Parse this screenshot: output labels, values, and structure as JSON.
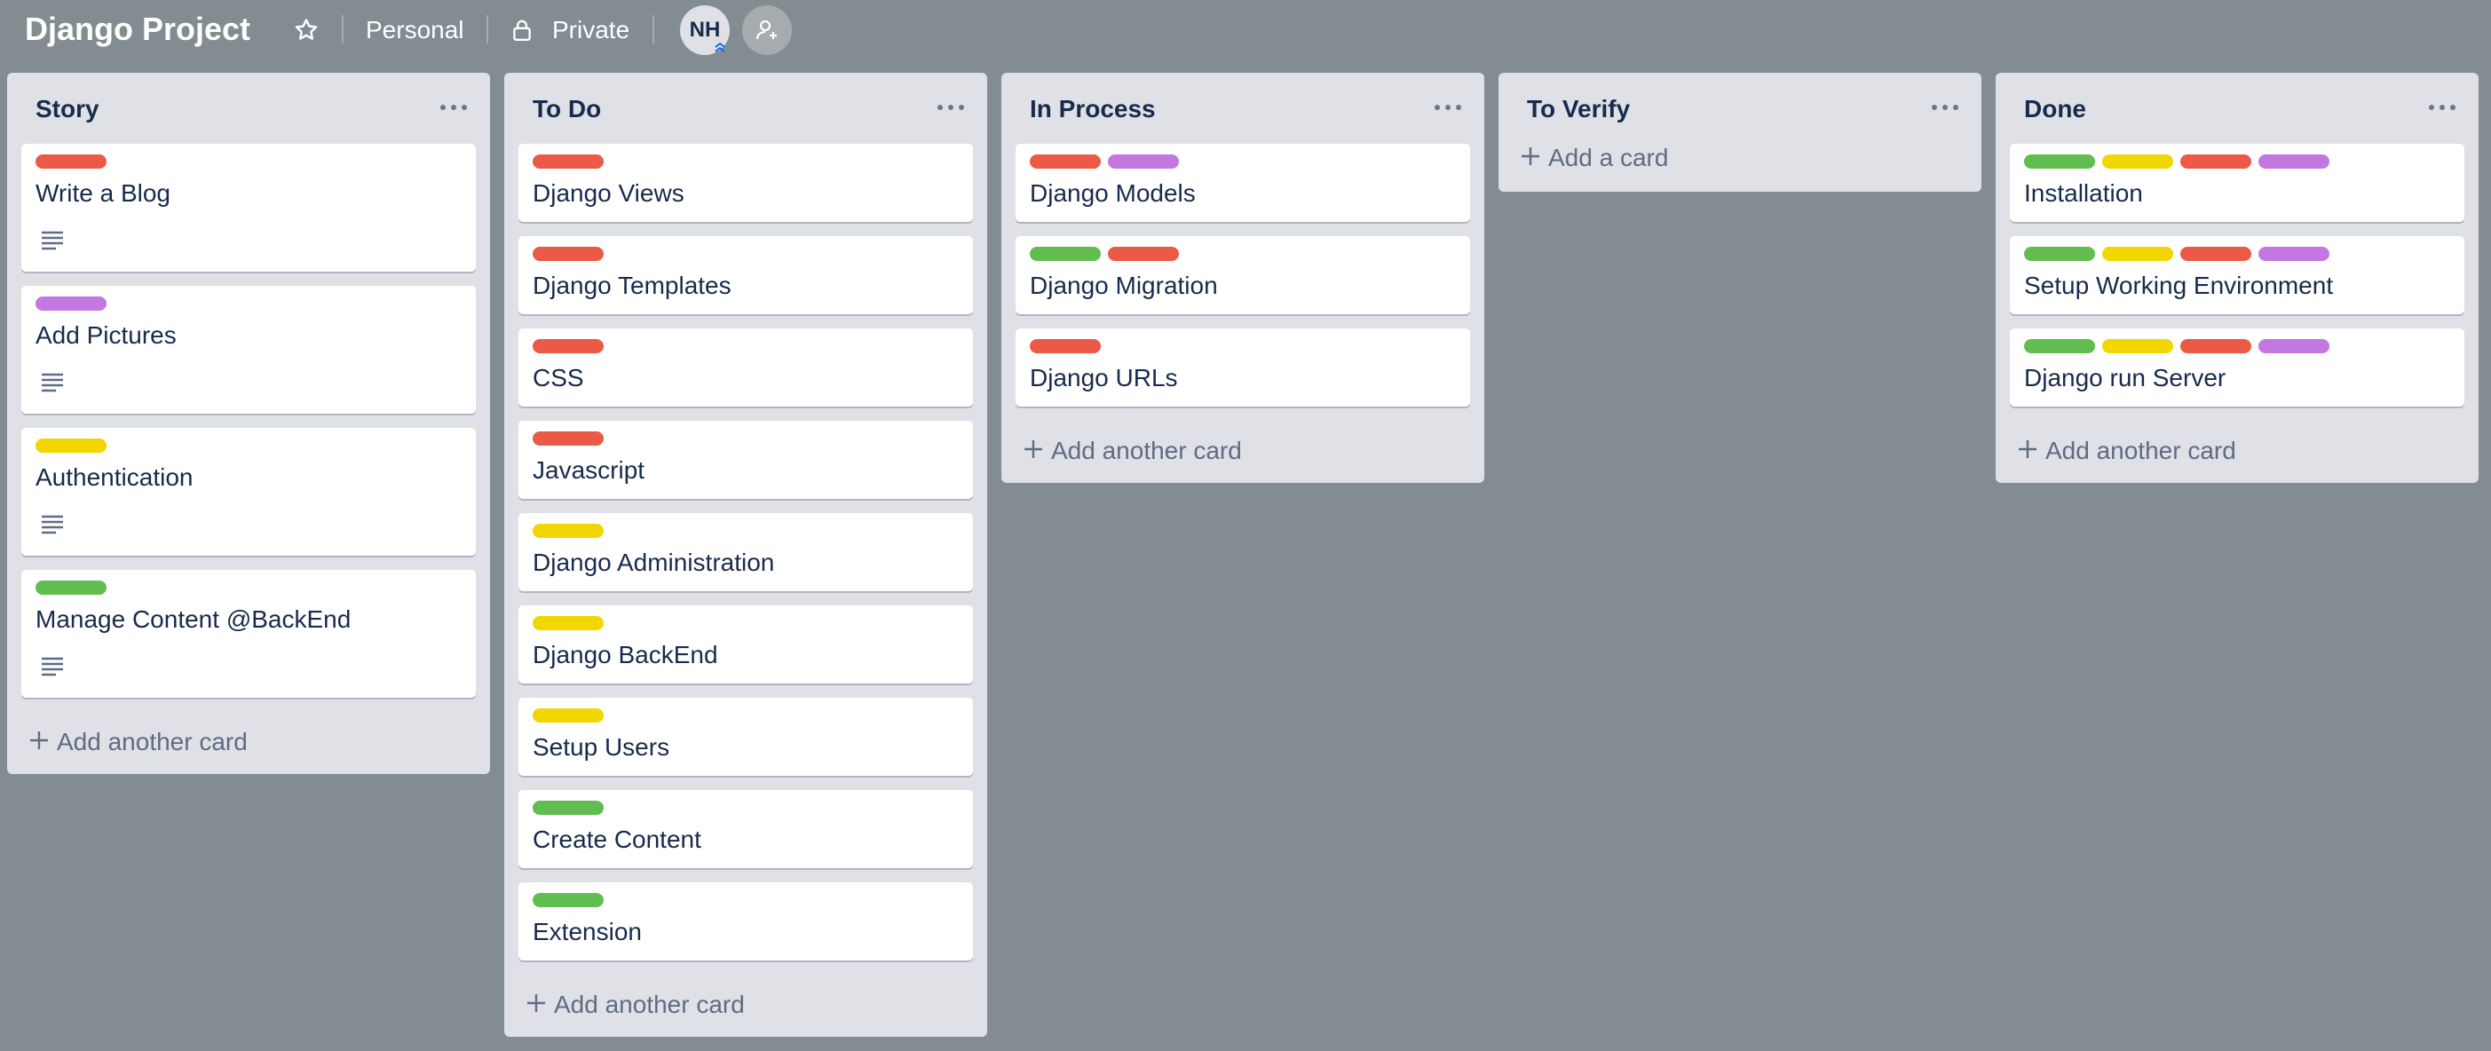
{
  "board": {
    "title": "Django Project",
    "visibility_team": "Personal",
    "visibility": "Private",
    "member_initials": "NH"
  },
  "colors": {
    "background": "#838c91",
    "list_background": "#dfe1e6",
    "label_red": "#eb5a46",
    "label_purple": "#c377e0",
    "label_yellow": "#f2d600",
    "label_green": "#61bd4f"
  },
  "icons": {
    "star": "star-icon",
    "lock": "lock-icon",
    "add_member": "add-member-icon",
    "list_menu": "ellipsis-icon",
    "description": "description-icon",
    "plus": "plus-icon"
  },
  "lists": [
    {
      "title": "Story",
      "cards": [
        {
          "title": "Write a Blog",
          "labels": [
            "red"
          ],
          "has_description": true
        },
        {
          "title": "Add Pictures",
          "labels": [
            "purple"
          ],
          "has_description": true
        },
        {
          "title": "Authentication",
          "labels": [
            "yellow"
          ],
          "has_description": true
        },
        {
          "title": "Manage Content @BackEnd",
          "labels": [
            "green"
          ],
          "has_description": true
        }
      ],
      "add_label": "Add another card"
    },
    {
      "title": "To Do",
      "cards": [
        {
          "title": "Django Views",
          "labels": [
            "red"
          ],
          "has_description": false
        },
        {
          "title": "Django Templates",
          "labels": [
            "red"
          ],
          "has_description": false
        },
        {
          "title": "CSS",
          "labels": [
            "red"
          ],
          "has_description": false
        },
        {
          "title": "Javascript",
          "labels": [
            "red"
          ],
          "has_description": false
        },
        {
          "title": "Django Administration",
          "labels": [
            "yellow"
          ],
          "has_description": false
        },
        {
          "title": "Django BackEnd",
          "labels": [
            "yellow"
          ],
          "has_description": false
        },
        {
          "title": "Setup Users",
          "labels": [
            "yellow"
          ],
          "has_description": false
        },
        {
          "title": "Create Content",
          "labels": [
            "green"
          ],
          "has_description": false
        },
        {
          "title": "Extension",
          "labels": [
            "green"
          ],
          "has_description": false
        }
      ],
      "add_label": "Add another card"
    },
    {
      "title": "In Process",
      "cards": [
        {
          "title": "Django Models",
          "labels": [
            "red",
            "purple"
          ],
          "has_description": false
        },
        {
          "title": "Django Migration",
          "labels": [
            "green",
            "red"
          ],
          "has_description": false
        },
        {
          "title": "Django URLs",
          "labels": [
            "red"
          ],
          "has_description": false
        }
      ],
      "add_label": "Add another card"
    },
    {
      "title": "To Verify",
      "cards": [],
      "add_label": "Add a card"
    },
    {
      "title": "Done",
      "cards": [
        {
          "title": "Installation",
          "labels": [
            "green",
            "yellow",
            "red",
            "purple"
          ],
          "has_description": false
        },
        {
          "title": "Setup Working Environment",
          "labels": [
            "green",
            "yellow",
            "red",
            "purple"
          ],
          "has_description": false
        },
        {
          "title": "Django run Server",
          "labels": [
            "green",
            "yellow",
            "red",
            "purple"
          ],
          "has_description": false
        }
      ],
      "add_label": "Add another card"
    }
  ]
}
